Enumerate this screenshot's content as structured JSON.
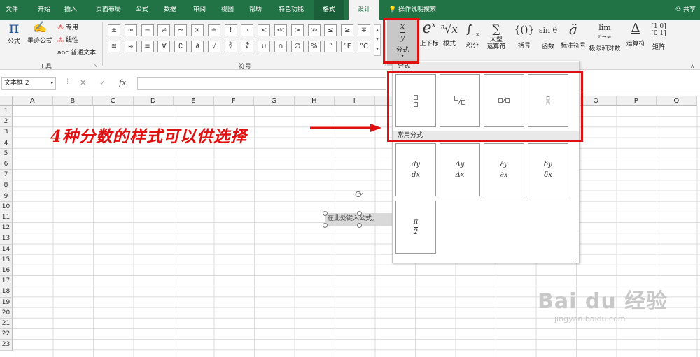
{
  "tabs": [
    "文件",
    "开始",
    "插入",
    "页面布局",
    "公式",
    "数据",
    "审阅",
    "视图",
    "帮助",
    "特色功能",
    "格式",
    "设计"
  ],
  "tell_me": "操作说明搜索",
  "share": "共享",
  "tools": {
    "equation": "公式",
    "ink": "墨迹公式",
    "professional": "专用",
    "linear": "线性",
    "normal_text": "abc 普通文本",
    "group": "工具"
  },
  "symbols": {
    "row1": [
      "±",
      "∞",
      "=",
      "≠",
      "~",
      "×",
      "÷",
      "!",
      "∝",
      "<",
      "≪",
      ">",
      "≫",
      "≤",
      "≥",
      "∓"
    ],
    "row2": [
      "≅",
      "≈",
      "≡",
      "∀",
      "∁",
      "∂",
      "√",
      "∛",
      "∜",
      "∪",
      "∩",
      "∅",
      "%",
      "°",
      "°F",
      "°C"
    ],
    "group": "符号"
  },
  "structures": [
    {
      "glyph": "x⁄y",
      "label": "分式"
    },
    {
      "glyph": "eˣ",
      "label": "上下标"
    },
    {
      "glyph": "ⁿ√x",
      "label": "根式"
    },
    {
      "glyph": "∫",
      "label": "积分"
    },
    {
      "glyph": "∑",
      "label": "大型\n运算符"
    },
    {
      "glyph": "{()}",
      "label": "括号"
    },
    {
      "glyph": "sinθ",
      "label": "函数"
    },
    {
      "glyph": "ä",
      "label": "标注符号"
    },
    {
      "glyph": "lim",
      "label": "极限和对数"
    },
    {
      "glyph": "Δ",
      "label": "运算符"
    },
    {
      "glyph": "[10;01]",
      "label": "矩阵"
    }
  ],
  "name_box": "文本框 2",
  "columns": [
    "A",
    "B",
    "C",
    "D",
    "E",
    "F",
    "G",
    "H",
    "I",
    "J",
    "K",
    "L",
    "M",
    "N",
    "O",
    "P",
    "Q"
  ],
  "rows": [
    "1",
    "2",
    "3",
    "4",
    "5",
    "6",
    "7",
    "8",
    "9",
    "10",
    "11",
    "12",
    "13",
    "14",
    "15",
    "16",
    "17",
    "18",
    "19",
    "20",
    "21",
    "22",
    "23"
  ],
  "gallery": {
    "section1": "分式",
    "section2": "常用分式",
    "common": [
      {
        "num": "dy",
        "den": "dx"
      },
      {
        "num": "Δy",
        "den": "Δx"
      },
      {
        "num": "∂y",
        "den": "∂x"
      },
      {
        "num": "δy",
        "den": "δx"
      },
      {
        "num": "π",
        "den": "2"
      }
    ]
  },
  "annotation": "4种分数的样式可以供选择",
  "textbox": "在此处键入公式。",
  "watermark": {
    "brand": "Bai du 经验",
    "url": "jingyan.baidu.com"
  },
  "colors": {
    "excel_green": "#217346",
    "annotation_red": "#e01010"
  }
}
